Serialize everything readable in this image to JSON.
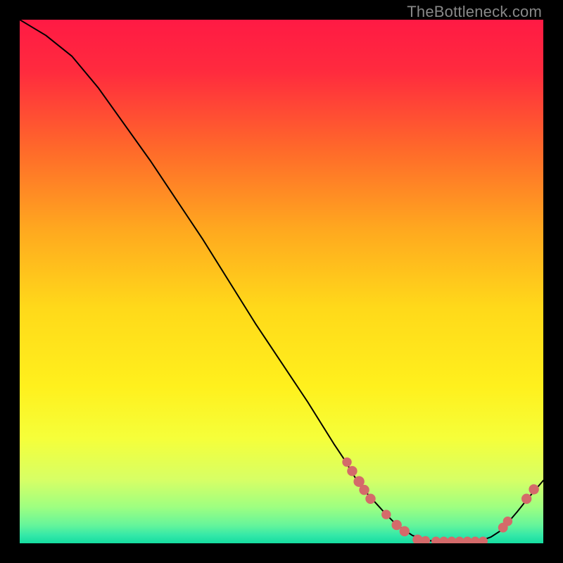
{
  "watermark": "TheBottleneck.com",
  "colors": {
    "background": "#000000",
    "curve": "#000000",
    "dot": "#d46a6a",
    "gradient_stops": [
      {
        "offset": 0.0,
        "color": "#ff1a44"
      },
      {
        "offset": 0.1,
        "color": "#ff2b3e"
      },
      {
        "offset": 0.25,
        "color": "#ff6a2a"
      },
      {
        "offset": 0.4,
        "color": "#ffa81f"
      },
      {
        "offset": 0.55,
        "color": "#ffd91a"
      },
      {
        "offset": 0.7,
        "color": "#fff01d"
      },
      {
        "offset": 0.8,
        "color": "#f5ff3a"
      },
      {
        "offset": 0.88,
        "color": "#d6ff66"
      },
      {
        "offset": 0.93,
        "color": "#9fff80"
      },
      {
        "offset": 0.965,
        "color": "#66f59a"
      },
      {
        "offset": 0.985,
        "color": "#33e8a8"
      },
      {
        "offset": 1.0,
        "color": "#15dca0"
      }
    ]
  },
  "chart_data": {
    "type": "line",
    "title": "",
    "xlabel": "",
    "ylabel": "",
    "xlim": [
      0,
      100
    ],
    "ylim": [
      0,
      100
    ],
    "series": [
      {
        "name": "curve",
        "x": [
          0,
          5,
          10,
          15,
          20,
          25,
          30,
          35,
          40,
          45,
          50,
          55,
          60,
          62,
          65,
          70,
          72,
          75,
          78,
          82.5,
          87.5,
          90,
          92,
          95,
          97,
          100
        ],
        "y": [
          100,
          97,
          93,
          87,
          80,
          73,
          65.5,
          58,
          50,
          42,
          34.5,
          27,
          19,
          16,
          11,
          5.5,
          3.5,
          1.5,
          0.5,
          0.3,
          0.3,
          1.2,
          2.5,
          6.0,
          8.5,
          12
        ]
      }
    ],
    "points": [
      {
        "x": 62.5,
        "y": 15.5,
        "r": 3.0
      },
      {
        "x": 63.5,
        "y": 13.8,
        "r": 3.5
      },
      {
        "x": 64.8,
        "y": 11.8,
        "r": 4.0
      },
      {
        "x": 65.8,
        "y": 10.2,
        "r": 3.5
      },
      {
        "x": 67.0,
        "y": 8.5,
        "r": 3.5
      },
      {
        "x": 70.0,
        "y": 5.5,
        "r": 3.0
      },
      {
        "x": 72.0,
        "y": 3.5,
        "r": 3.5
      },
      {
        "x": 73.5,
        "y": 2.3,
        "r": 3.5
      },
      {
        "x": 76.0,
        "y": 0.7,
        "r": 3.5
      },
      {
        "x": 77.5,
        "y": 0.5,
        "r": 2.8
      },
      {
        "x": 79.5,
        "y": 0.4,
        "r": 2.8
      },
      {
        "x": 81.0,
        "y": 0.4,
        "r": 2.8
      },
      {
        "x": 82.5,
        "y": 0.4,
        "r": 2.8
      },
      {
        "x": 84.0,
        "y": 0.4,
        "r": 2.8
      },
      {
        "x": 85.5,
        "y": 0.4,
        "r": 2.8
      },
      {
        "x": 87.0,
        "y": 0.4,
        "r": 2.8
      },
      {
        "x": 88.5,
        "y": 0.4,
        "r": 2.8
      },
      {
        "x": 92.3,
        "y": 3.0,
        "r": 3.2
      },
      {
        "x": 93.2,
        "y": 4.2,
        "r": 3.0
      },
      {
        "x": 96.8,
        "y": 8.5,
        "r": 3.5
      },
      {
        "x": 98.2,
        "y": 10.3,
        "r": 3.5
      }
    ]
  }
}
